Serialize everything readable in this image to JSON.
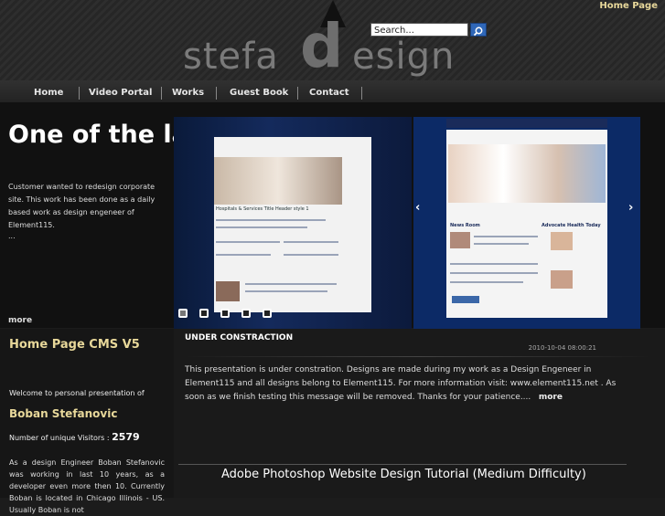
{
  "header": {
    "home_link": "Home Page",
    "logo_text_left": "stefa",
    "logo_d": "d",
    "logo_text_right": "esign",
    "search_placeholder": "Search...",
    "search_icon": "search-icon"
  },
  "nav": {
    "items": [
      {
        "label": "Home"
      },
      {
        "label": "Video Portal"
      },
      {
        "label": "Works"
      },
      {
        "label": "Guest Book"
      },
      {
        "label": "Contact"
      }
    ]
  },
  "slider": {
    "title": "One of the latest",
    "description": "Customer wanted to redesign corporate site. This work has been  done as a daily based work as design engeneer of Element115.",
    "ellipsis": "...",
    "more": "more",
    "left_page_heading": "Hospitals & Services Title Header style 1",
    "right_page_heading": "Advocate Health Today",
    "right_section": "News Room",
    "arrow_left": "‹",
    "arrow_right": "›"
  },
  "sidebar": {
    "heading": "Home Page CMS V5",
    "welcome": "Welcome to personal presentation of",
    "name": "Boban Stefanovic",
    "visitors_label": "Number of unique Visitors : ",
    "visitors_count": "2579",
    "bio": "As a design Engineer Boban Stefanovic was working in last 10 years, as a developer even more then 10. Currently Boban is located in Chicago Illinois - US. Usually Boban is not"
  },
  "post": {
    "title": "UNDER CONSTRACTION",
    "date": "2010-10-04 08:00:21",
    "body": "This presentation is under constration. Designs are made during my work as a Design Engeneer in Element115 and all designs belong to Element115.  For more information  visit: www.element115.net . As soon as we finish testing this message will be removed. Thanks for your patience....",
    "more": "more"
  },
  "tutorial": {
    "title": "Adobe Photoshop Website Design Tutorial (Medium Difficulty)"
  },
  "colors": {
    "accent_gold": "#e8d89a",
    "search_button": "#2f67b8",
    "slide_blue": "#0c2a66"
  }
}
